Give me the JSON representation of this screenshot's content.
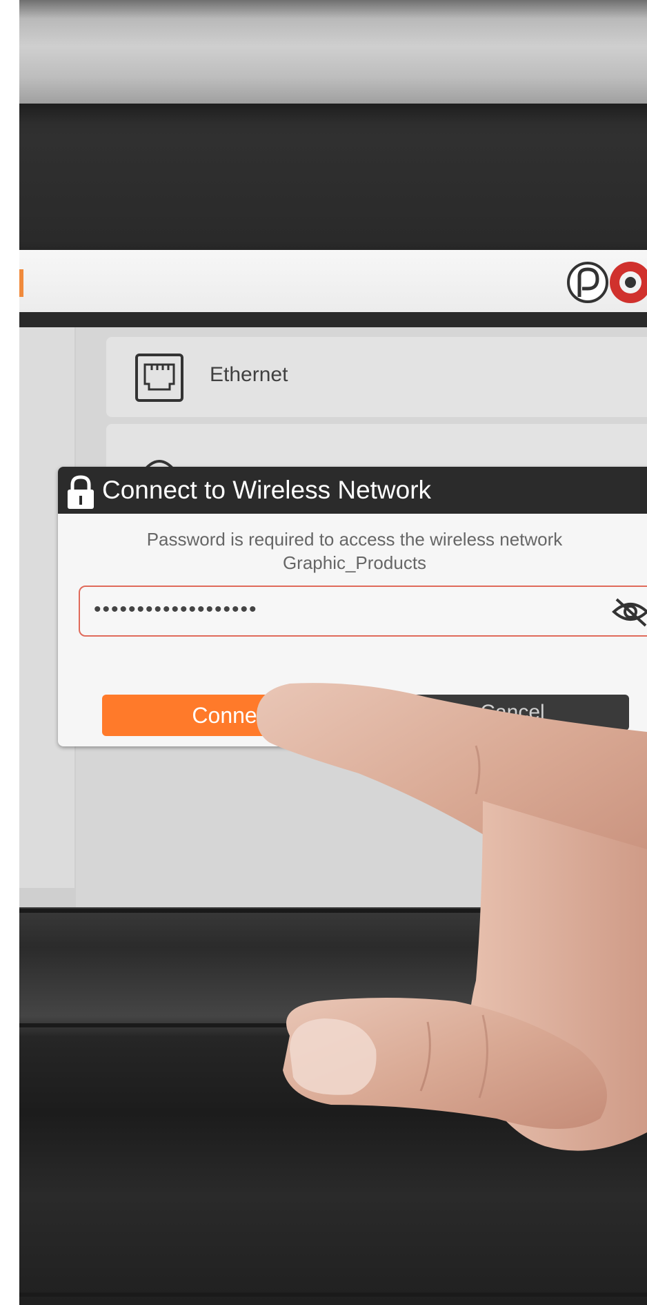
{
  "header": {
    "logo_icon": "brand-logo"
  },
  "network_list": {
    "items": [
      {
        "label": "Ethernet",
        "icon": "ethernet-port-icon"
      },
      {
        "label": "",
        "icon": "wifi-icon"
      }
    ]
  },
  "dialog": {
    "title": "Connect to Wireless Network",
    "title_icon": "lock-icon",
    "message_line1": "Password is required to access the wireless network",
    "message_line2": "Graphic_Products",
    "password_value": "•••••••••••••••••••",
    "visibility_icon": "eye-slash-icon",
    "connect_label": "Connect",
    "cancel_label": "Cancel"
  },
  "colors": {
    "accent": "#ff7a2a",
    "title_bar": "#2b2b2b",
    "field_border": "#e06a5a",
    "logo_red": "#d0312d"
  }
}
